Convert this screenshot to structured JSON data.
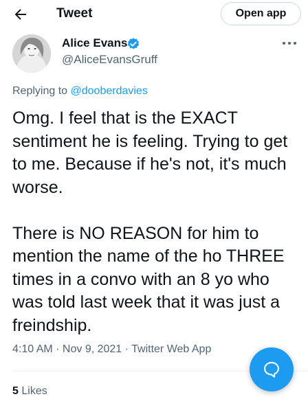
{
  "header": {
    "title": "Tweet",
    "open_app_label": "Open app",
    "back_icon": "arrow-left-icon"
  },
  "author": {
    "name": "Alice Evans",
    "handle": "@AliceEvansGruff",
    "verified": true,
    "avatar": "profile-photo"
  },
  "reply": {
    "prefix": "Replying to",
    "mention": "@dooberdavies"
  },
  "tweet": {
    "paragraphs": [
      "Omg. I feel that is the EXACT sentiment he is feeling. Trying to get to me. Because if he's not, it's much worse.",
      "There is NO REASON for him to mention the name of the ho THREE times in a convo with an 8 yo who was told last week that it was just a freindship."
    ],
    "time": "4:10 AM",
    "date": "Nov 9, 2021",
    "source": "Twitter Web App",
    "separator": " · "
  },
  "stats": {
    "likes_count": "5",
    "likes_label": "Likes"
  },
  "colors": {
    "accent": "#1d9bf0",
    "secondary_text": "#536471",
    "primary_text": "#0f1419"
  },
  "fab": {
    "icon": "compose-reply-icon"
  }
}
